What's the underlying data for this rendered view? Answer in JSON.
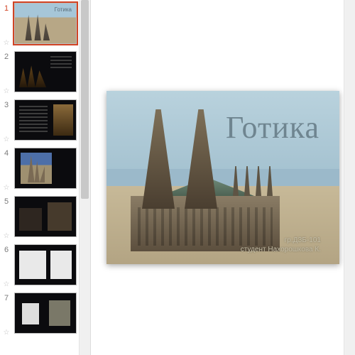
{
  "thumbnails": [
    {
      "number": "1",
      "active": true,
      "label": "Готика"
    },
    {
      "number": "2",
      "active": false
    },
    {
      "number": "3",
      "active": false
    },
    {
      "number": "4",
      "active": false
    },
    {
      "number": "5",
      "active": false
    },
    {
      "number": "6",
      "active": false
    },
    {
      "number": "7",
      "active": false
    }
  ],
  "slide": {
    "title": "Готика",
    "subtitle1": "гр.ДЗБ-101",
    "subtitle2": "студент Нахорошкова К."
  }
}
